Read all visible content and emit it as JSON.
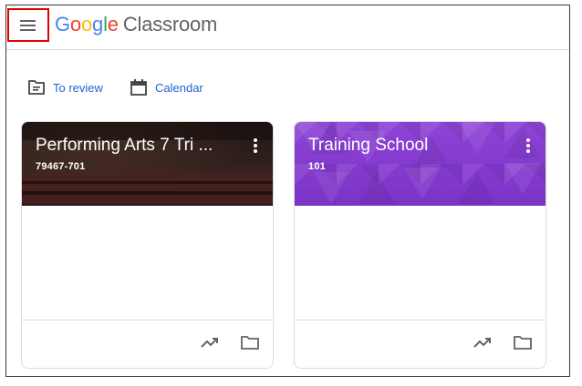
{
  "header": {
    "logo_letters": [
      "G",
      "o",
      "o",
      "g",
      "l",
      "e"
    ],
    "product": "Classroom",
    "menu_icon": "hamburger-menu-icon",
    "highlight_color": "#e00000"
  },
  "nav_links": [
    {
      "label": "To review",
      "icon": "to-review-icon"
    },
    {
      "label": "Calendar",
      "icon": "calendar-icon"
    }
  ],
  "classes": [
    {
      "title": "Performing Arts 7 Tri ...",
      "section": "79467-701",
      "theme": "theater-seats-image"
    },
    {
      "title": "Training School",
      "section": "101",
      "theme": "purple-geometric-pattern",
      "theme_color": "#8e44d6"
    }
  ],
  "card_footer_icons": [
    "trending-up-icon",
    "folder-icon"
  ],
  "colors": {
    "link": "#1967d2",
    "google_blue": "#4285f4",
    "google_red": "#ea4335",
    "google_yellow": "#fbbc05",
    "google_green": "#34a853"
  }
}
